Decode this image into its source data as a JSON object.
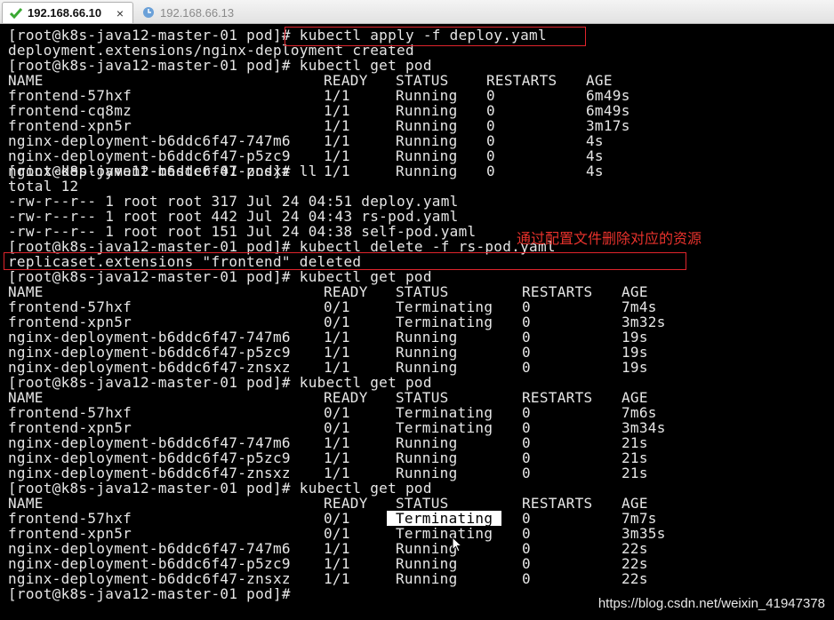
{
  "tabs": [
    {
      "label": "192.168.66.10",
      "close": "×"
    },
    {
      "label": "192.168.66.13"
    }
  ],
  "annotation": "通过配置文件删除对应的资源",
  "watermark": "https://blog.csdn.net/weixin_41947378",
  "prompt_lines": {
    "l0": "[root@k8s-java12-master-01 pod]# kubectl apply -f deploy.yaml",
    "l1": "deployment.extensions/nginx-deployment created",
    "l2": "[root@k8s-java12-master-01 pod]# kubectl get pod",
    "l9": "[root@k8s-java12-master-01 pod]# ll",
    "l10": "total 12",
    "l11": "-rw-r--r-- 1 root root 317 Jul 24 04:51 deploy.yaml",
    "l12": "-rw-r--r-- 1 root root 442 Jul 24 04:43 rs-pod.yaml",
    "l13": "-rw-r--r-- 1 root root 151 Jul 24 04:38 self-pod.yaml",
    "l14": "[root@k8s-java12-master-01 pod]# kubectl delete -f rs-pod.yaml",
    "l15": "replicaset.extensions \"frontend\" deleted",
    "l16": "[root@k8s-java12-master-01 pod]# kubectl get pod",
    "l23": "[root@k8s-java12-master-01 pod]# kubectl get pod",
    "l30": "[root@k8s-java12-master-01 pod]# kubectl get pod",
    "l37": "[root@k8s-java12-master-01 pod]#"
  },
  "tables": [
    {
      "header": [
        "NAME",
        "READY",
        "STATUS",
        "RESTARTS",
        "AGE"
      ],
      "rows": [
        [
          "frontend-57hxf",
          "1/1",
          "Running",
          "0",
          "6m49s"
        ],
        [
          "frontend-cq8mz",
          "1/1",
          "Running",
          "0",
          "6m49s"
        ],
        [
          "frontend-xpn5r",
          "1/1",
          "Running",
          "0",
          "3m17s"
        ],
        [
          "nginx-deployment-b6ddc6f47-747m6",
          "1/1",
          "Running",
          "0",
          "4s"
        ],
        [
          "nginx-deployment-b6ddc6f47-p5zc9",
          "1/1",
          "Running",
          "0",
          "4s"
        ],
        [
          "nginx-deployment-b6ddc6f47-znsxz",
          "1/1",
          "Running",
          "0",
          "4s"
        ]
      ]
    },
    {
      "header": [
        "NAME",
        "READY",
        "STATUS",
        "RESTARTS",
        "AGE"
      ],
      "rows": [
        [
          "frontend-57hxf",
          "0/1",
          "Terminating",
          "0",
          "7m4s"
        ],
        [
          "frontend-xpn5r",
          "0/1",
          "Terminating",
          "0",
          "3m32s"
        ],
        [
          "nginx-deployment-b6ddc6f47-747m6",
          "1/1",
          "Running",
          "0",
          "19s"
        ],
        [
          "nginx-deployment-b6ddc6f47-p5zc9",
          "1/1",
          "Running",
          "0",
          "19s"
        ],
        [
          "nginx-deployment-b6ddc6f47-znsxz",
          "1/1",
          "Running",
          "0",
          "19s"
        ]
      ]
    },
    {
      "header": [
        "NAME",
        "READY",
        "STATUS",
        "RESTARTS",
        "AGE"
      ],
      "rows": [
        [
          "frontend-57hxf",
          "0/1",
          "Terminating",
          "0",
          "7m6s"
        ],
        [
          "frontend-xpn5r",
          "0/1",
          "Terminating",
          "0",
          "3m34s"
        ],
        [
          "nginx-deployment-b6ddc6f47-747m6",
          "1/1",
          "Running",
          "0",
          "21s"
        ],
        [
          "nginx-deployment-b6ddc6f47-p5zc9",
          "1/1",
          "Running",
          "0",
          "21s"
        ],
        [
          "nginx-deployment-b6ddc6f47-znsxz",
          "1/1",
          "Running",
          "0",
          "21s"
        ]
      ]
    },
    {
      "header": [
        "NAME",
        "READY",
        "STATUS",
        "RESTARTS",
        "AGE"
      ],
      "rows": [
        [
          "frontend-57hxf",
          "0/1",
          "Terminating",
          "0",
          "7m7s"
        ],
        [
          "frontend-xpn5r",
          "0/1",
          "Terminating",
          "0",
          "3m35s"
        ],
        [
          "nginx-deployment-b6ddc6f47-747m6",
          "1/1",
          "Running",
          "0",
          "22s"
        ],
        [
          "nginx-deployment-b6ddc6f47-p5zc9",
          "1/1",
          "Running",
          "0",
          "22s"
        ],
        [
          "nginx-deployment-b6ddc6f47-znsxz",
          "1/1",
          "Running",
          "0",
          "22s"
        ]
      ]
    }
  ],
  "colors": {
    "highlight": "#e0242c",
    "annotation": "#e8322c",
    "check": "#3aa832"
  },
  "icons": [
    "check-icon",
    "close-icon",
    "clock-icon",
    "mouse-cursor-icon"
  ]
}
